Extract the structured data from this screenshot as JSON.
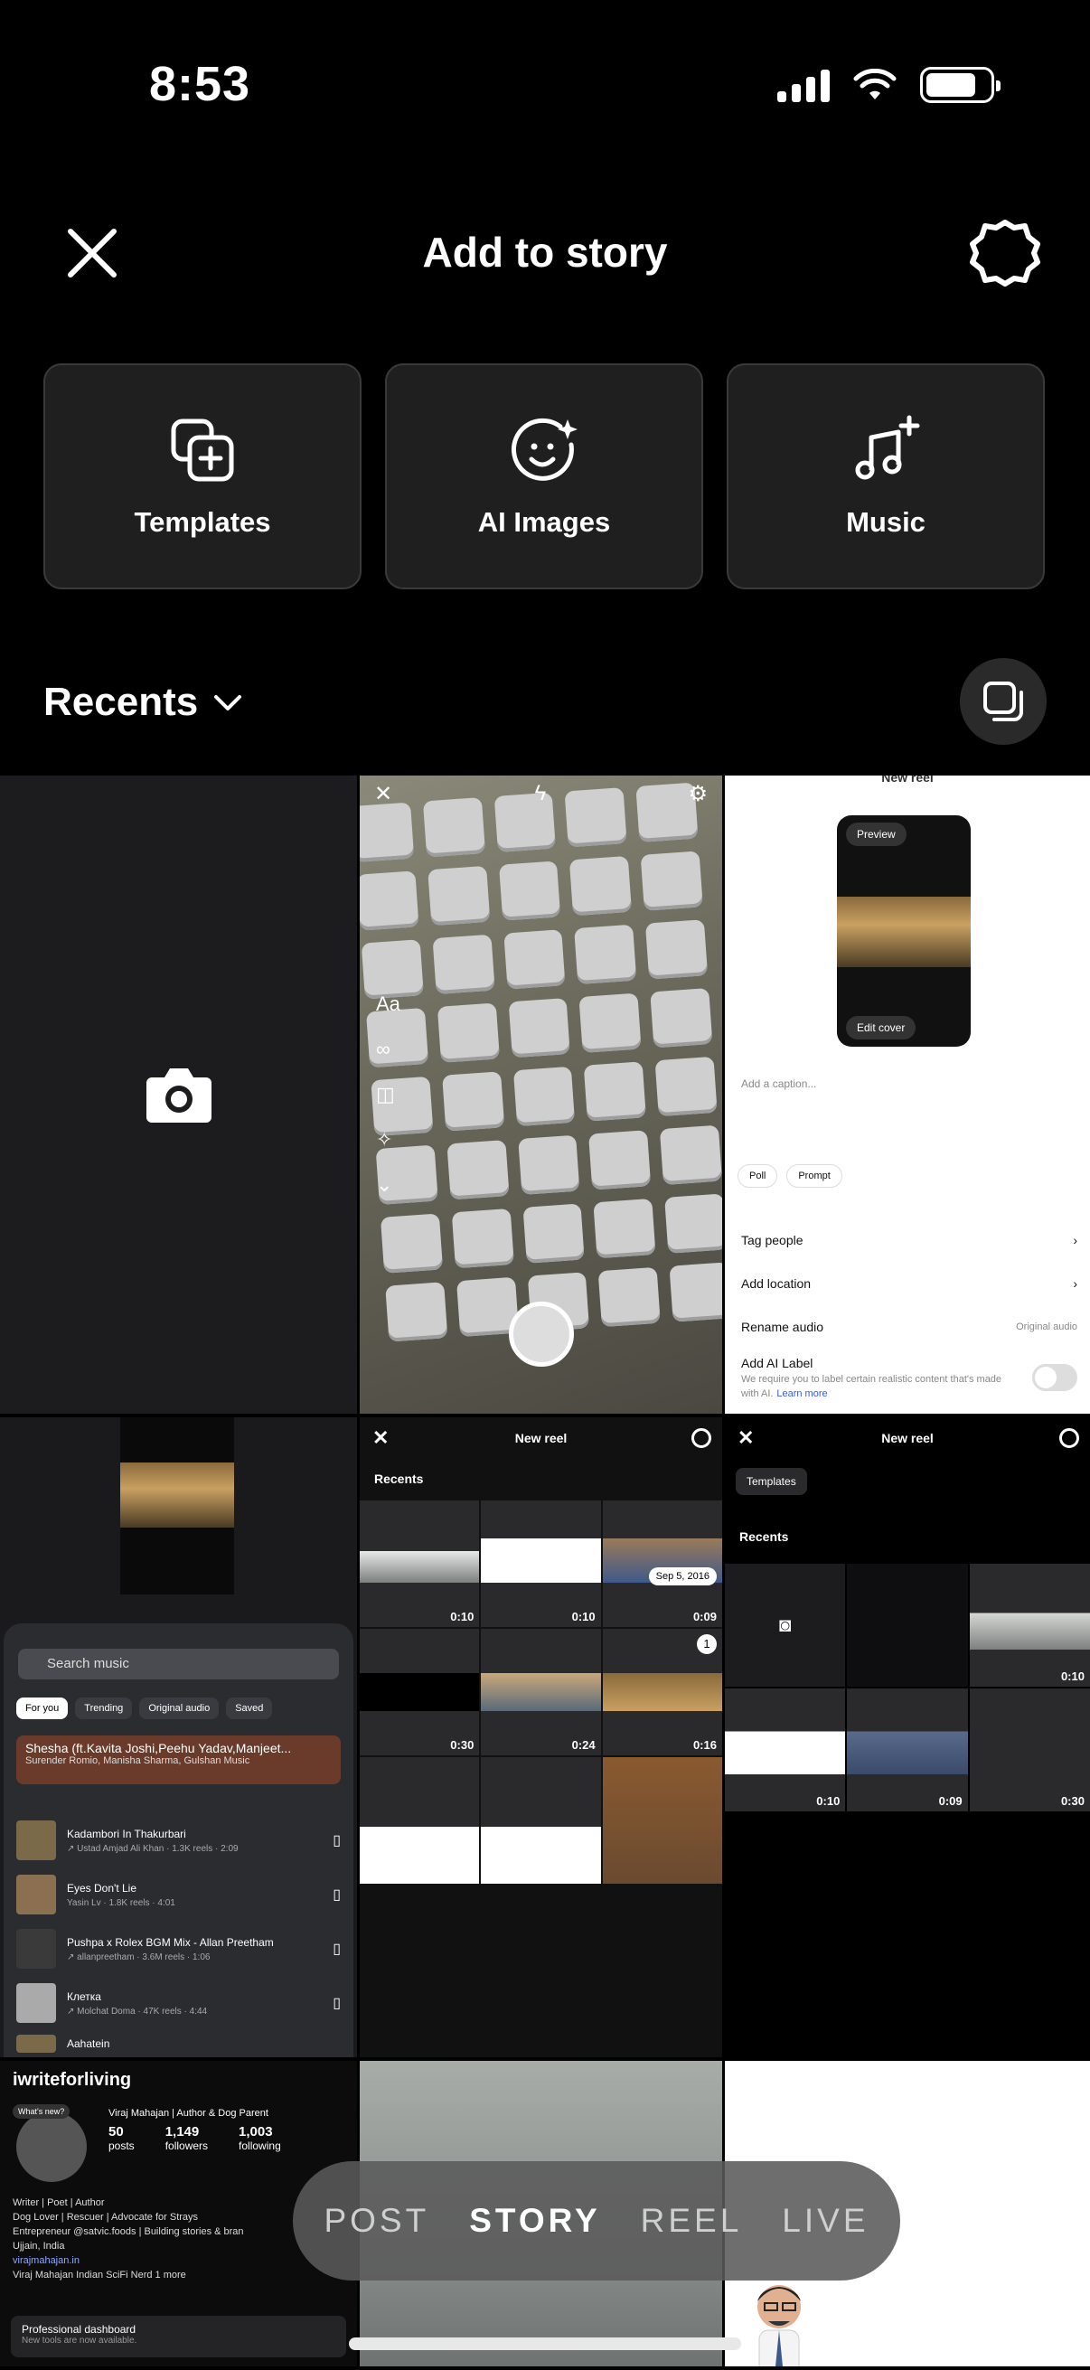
{
  "status_bar": {
    "time": "8:53"
  },
  "header": {
    "title": "Add to story"
  },
  "tiles": [
    {
      "label": "Templates",
      "icon": "templates-icon"
    },
    {
      "label": "AI Images",
      "icon": "ai-images-icon"
    },
    {
      "label": "Music",
      "icon": "music-icon"
    }
  ],
  "recents": {
    "label": "Recents"
  },
  "grid": {
    "keyboard": {
      "text_tool": "Aa",
      "loop_tool": "∞"
    },
    "new_reel": {
      "title": "New reel",
      "preview": "Preview",
      "edit_cover": "Edit cover",
      "caption_placeholder": "Add a caption...",
      "chips": [
        "Poll",
        "Prompt"
      ],
      "rows": [
        "Tag people",
        "Add location",
        "Rename audio",
        "Add AI Label"
      ],
      "audio_value": "Original audio",
      "ai_label_sub": "We require you to label certain realistic content that's made with AI.",
      "learn_more": "Learn more"
    },
    "music": {
      "search_placeholder": "Search music",
      "tabs": [
        "For you",
        "Trending",
        "Original audio",
        "Saved"
      ],
      "feature_title": "Shesha (ft.Kavita Joshi,Peehu Yadav,Manjeet...",
      "feature_sub": "Surender Romio, Manisha Sharma, Gulshan Music",
      "items": [
        {
          "title": "Kadambori In Thakurbari",
          "sub": "↗ Ustad Amjad Ali Khan · 1.3K reels · 2:09"
        },
        {
          "title": "Eyes Don't Lie",
          "sub": "Yasin Lv · 1.8K reels · 4:01"
        },
        {
          "title": "Pushpa x Rolex BGM Mix - Allan Preetham",
          "sub": "↗ allanpreetham · 3.6M reels · 1:06"
        },
        {
          "title": "Клетка",
          "sub": "↗ Molchat Doma · 47K reels · 4:44"
        },
        {
          "title": "Aahatein",
          "sub": ""
        }
      ]
    },
    "picker_1": {
      "title": "New reel",
      "recents": "Recents",
      "date_badge": "Sep 5, 2016",
      "durations": [
        "0:10",
        "0:10",
        "0:09",
        "0:30",
        "0:24",
        "0:16"
      ],
      "selected_count": "1"
    },
    "picker_2": {
      "title": "New reel",
      "templates": "Templates",
      "recents": "Recents",
      "durations": [
        "0:10",
        "0:10",
        "0:09",
        "0:30"
      ]
    },
    "profile": {
      "handle": "iwriteforliving",
      "note": "What's new?",
      "name": "Viraj Mahajan | Author & Dog Parent",
      "stats": [
        {
          "value": "50",
          "label": "posts"
        },
        {
          "value": "1,149",
          "label": "followers"
        },
        {
          "value": "1,003",
          "label": "following"
        }
      ],
      "bio": [
        "Writer | Poet | Author",
        "Dog Lover | Rescuer | Advocate for Strays",
        "Entrepreneur @satvic.foods | Building stories & bran",
        "Ujjain, India",
        "virajmahajan.in"
      ],
      "links": "Viraj Mahajan   Indian SciFi Nerd   1 more",
      "dashboard_title": "Professional dashboard",
      "dashboard_sub": "New tools are now available."
    }
  },
  "modes": [
    "POST",
    "STORY",
    "REEL",
    "LIVE"
  ],
  "active_mode": "STORY"
}
